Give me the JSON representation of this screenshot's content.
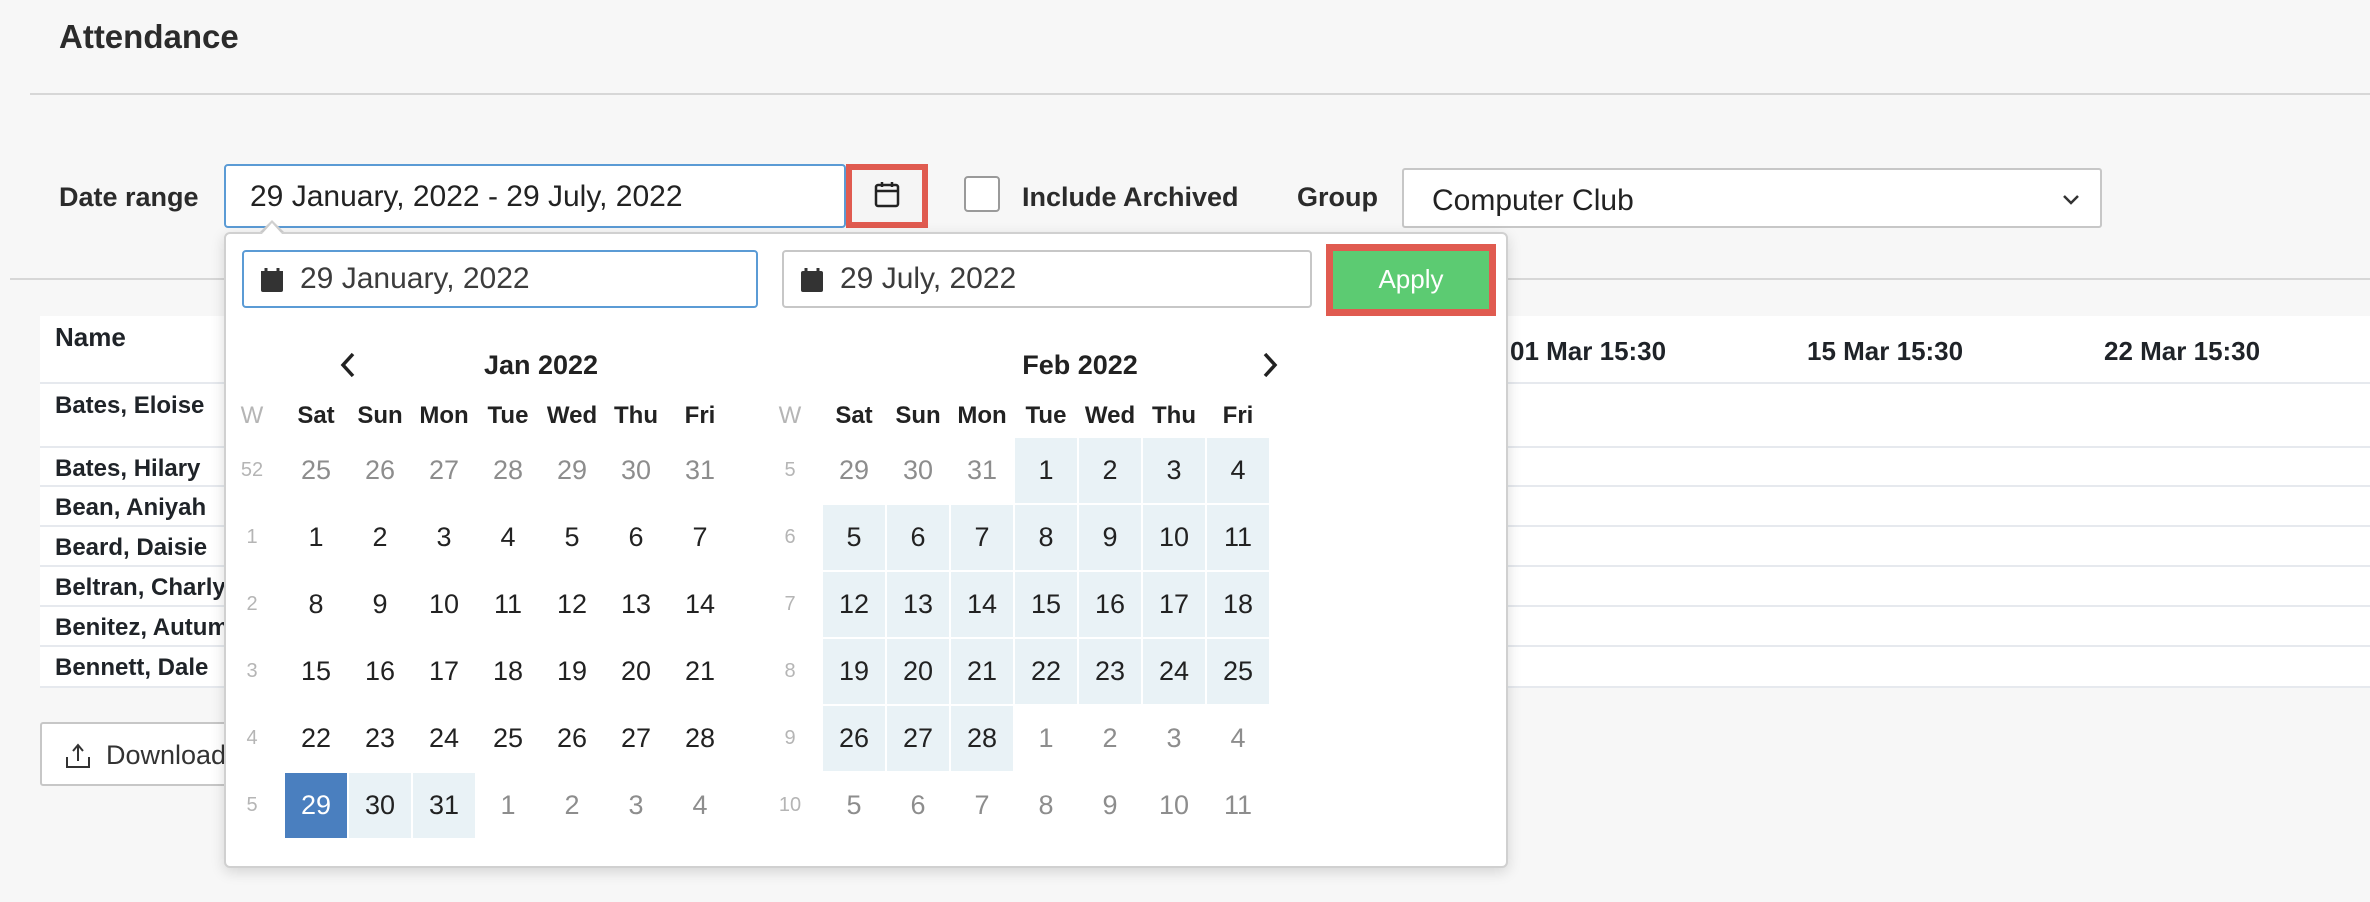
{
  "header": {
    "title": "Attendance"
  },
  "filters": {
    "date_range_label": "Date range",
    "date_range_value": "29 January, 2022 - 29 July, 2022",
    "include_archived_label": "Include Archived",
    "group_label": "Group",
    "group_value": "Computer Club"
  },
  "table": {
    "name_header": "Name",
    "date_headers": [
      "01 Mar 15:30",
      "15 Mar 15:30",
      "22 Mar 15:30"
    ],
    "rows": [
      "Bates, Eloise",
      "Bates, Hilary",
      "Bean, Aniyah",
      "Beard, Daisie",
      "Beltran, Charly",
      "Benitez, Autum",
      "Bennett, Dale"
    ]
  },
  "download_label": "Download",
  "picker": {
    "start_date": "29 January, 2022",
    "end_date": "29 July, 2022",
    "apply_label": "Apply",
    "weekday_headers": [
      "W",
      "Sat",
      "Sun",
      "Mon",
      "Tue",
      "Wed",
      "Thu",
      "Fri"
    ],
    "months": [
      {
        "title": "Jan 2022",
        "weeks": [
          {
            "w": "52",
            "days": [
              {
                "d": "25",
                "o": true
              },
              {
                "d": "26",
                "o": true
              },
              {
                "d": "27",
                "o": true
              },
              {
                "d": "28",
                "o": true
              },
              {
                "d": "29",
                "o": true
              },
              {
                "d": "30",
                "o": true
              },
              {
                "d": "31",
                "o": true
              }
            ]
          },
          {
            "w": "1",
            "days": [
              {
                "d": "1"
              },
              {
                "d": "2"
              },
              {
                "d": "3"
              },
              {
                "d": "4"
              },
              {
                "d": "5"
              },
              {
                "d": "6"
              },
              {
                "d": "7"
              }
            ]
          },
          {
            "w": "2",
            "days": [
              {
                "d": "8"
              },
              {
                "d": "9"
              },
              {
                "d": "10"
              },
              {
                "d": "11"
              },
              {
                "d": "12"
              },
              {
                "d": "13"
              },
              {
                "d": "14"
              }
            ]
          },
          {
            "w": "3",
            "days": [
              {
                "d": "15"
              },
              {
                "d": "16"
              },
              {
                "d": "17"
              },
              {
                "d": "18"
              },
              {
                "d": "19"
              },
              {
                "d": "20"
              },
              {
                "d": "21"
              }
            ]
          },
          {
            "w": "4",
            "days": [
              {
                "d": "22"
              },
              {
                "d": "23"
              },
              {
                "d": "24"
              },
              {
                "d": "25"
              },
              {
                "d": "26"
              },
              {
                "d": "27"
              },
              {
                "d": "28"
              }
            ]
          },
          {
            "w": "5",
            "days": [
              {
                "d": "29",
                "s": true
              },
              {
                "d": "30",
                "r": true
              },
              {
                "d": "31",
                "r": true
              },
              {
                "d": "1",
                "o": true
              },
              {
                "d": "2",
                "o": true
              },
              {
                "d": "3",
                "o": true
              },
              {
                "d": "4",
                "o": true
              }
            ]
          }
        ]
      },
      {
        "title": "Feb 2022",
        "weeks": [
          {
            "w": "5",
            "days": [
              {
                "d": "29",
                "o": true
              },
              {
                "d": "30",
                "o": true
              },
              {
                "d": "31",
                "o": true
              },
              {
                "d": "1",
                "r": true
              },
              {
                "d": "2",
                "r": true
              },
              {
                "d": "3",
                "r": true
              },
              {
                "d": "4",
                "r": true
              }
            ]
          },
          {
            "w": "6",
            "days": [
              {
                "d": "5",
                "r": true
              },
              {
                "d": "6",
                "r": true
              },
              {
                "d": "7",
                "r": true
              },
              {
                "d": "8",
                "r": true
              },
              {
                "d": "9",
                "r": true
              },
              {
                "d": "10",
                "r": true
              },
              {
                "d": "11",
                "r": true
              }
            ]
          },
          {
            "w": "7",
            "days": [
              {
                "d": "12",
                "r": true
              },
              {
                "d": "13",
                "r": true
              },
              {
                "d": "14",
                "r": true
              },
              {
                "d": "15",
                "r": true
              },
              {
                "d": "16",
                "r": true
              },
              {
                "d": "17",
                "r": true
              },
              {
                "d": "18",
                "r": true
              }
            ]
          },
          {
            "w": "8",
            "days": [
              {
                "d": "19",
                "r": true
              },
              {
                "d": "20",
                "r": true
              },
              {
                "d": "21",
                "r": true
              },
              {
                "d": "22",
                "r": true
              },
              {
                "d": "23",
                "r": true
              },
              {
                "d": "24",
                "r": true
              },
              {
                "d": "25",
                "r": true
              }
            ]
          },
          {
            "w": "9",
            "days": [
              {
                "d": "26",
                "r": true
              },
              {
                "d": "27",
                "r": true
              },
              {
                "d": "28",
                "r": true
              },
              {
                "d": "1",
                "o": true
              },
              {
                "d": "2",
                "o": true
              },
              {
                "d": "3",
                "o": true
              },
              {
                "d": "4",
                "o": true
              }
            ]
          },
          {
            "w": "10",
            "days": [
              {
                "d": "5",
                "o": true
              },
              {
                "d": "6",
                "o": true
              },
              {
                "d": "7",
                "o": true
              },
              {
                "d": "8",
                "o": true
              },
              {
                "d": "9",
                "o": true
              },
              {
                "d": "10",
                "o": true
              },
              {
                "d": "11",
                "o": true
              }
            ]
          }
        ]
      }
    ]
  },
  "colors": {
    "accent_blue": "#4a7fbf",
    "range_bg": "#e9f2f6",
    "apply_green": "#5ccb72",
    "highlight_red": "#e05b50"
  },
  "icons": [
    "calendar-icon",
    "chevron-down-icon",
    "upload-icon",
    "chevron-left-icon",
    "chevron-right-icon"
  ]
}
